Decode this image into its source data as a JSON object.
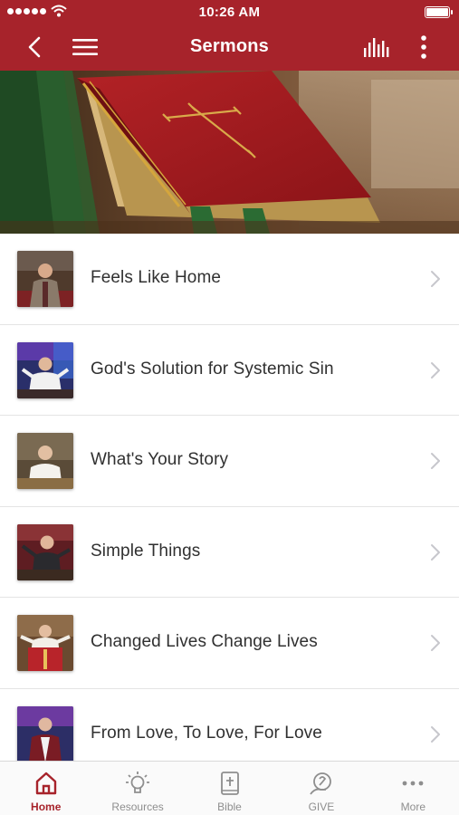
{
  "status_bar": {
    "time": "10:26 AM"
  },
  "nav": {
    "title": "Sermons",
    "back_icon": "chevron-left-icon",
    "menu_icon": "hamburger-menu-icon",
    "audio_icon": "equalizer-bars-icon",
    "more_icon": "vertical-ellipsis-icon"
  },
  "sermons": [
    {
      "title": "Feels Like Home"
    },
    {
      "title": "God's Solution for Systemic Sin"
    },
    {
      "title": "What's Your Story"
    },
    {
      "title": "Simple Things"
    },
    {
      "title": "Changed Lives Change Lives"
    },
    {
      "title": "From Love, To Love, For Love"
    }
  ],
  "tabs": [
    {
      "label": "Home",
      "icon": "home-icon",
      "active": true
    },
    {
      "label": "Resources",
      "icon": "lightbulb-icon",
      "active": false
    },
    {
      "label": "Bible",
      "icon": "bible-icon",
      "active": false
    },
    {
      "label": "GIVE",
      "icon": "give-icon",
      "active": false
    },
    {
      "label": "More",
      "icon": "more-dots-icon",
      "active": false
    }
  ],
  "colors": {
    "brand_red": "#a7232b",
    "tab_inactive": "#8e8e8e",
    "title_text": "#303030"
  }
}
